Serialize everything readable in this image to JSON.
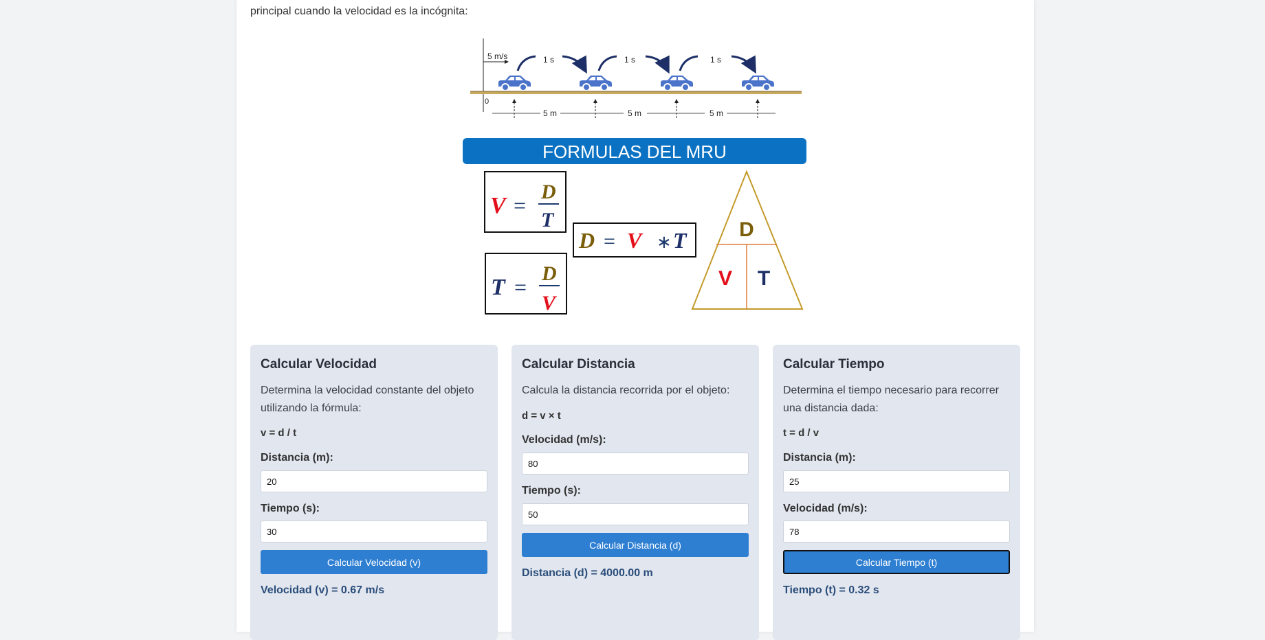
{
  "intro_text": "principal cuando la velocidad es la incógnita:",
  "motion_diagram": {
    "speed_label": "5 m/s",
    "origin_label": "0",
    "time_labels": [
      "1 s",
      "1 s",
      "1 s"
    ],
    "distance_labels": [
      "5 m",
      "5 m",
      "5 m"
    ]
  },
  "formulas_banner": {
    "title": "FORMULAS DEL MRU",
    "velocity": {
      "lhs": "V",
      "num": "D",
      "den": "T"
    },
    "time": {
      "lhs": "T",
      "num": "D",
      "den": "V"
    },
    "distance": {
      "lhs": "D",
      "a": "V",
      "op": "∗",
      "b": "T"
    },
    "triangle": {
      "top": "D",
      "left": "V",
      "right": "T"
    },
    "colors": {
      "distance": "#7a5e0a",
      "velocity": "#e3101b",
      "time": "#1d2f66",
      "banner": "#0b72c3"
    }
  },
  "calculators": {
    "velocity": {
      "title": "Calcular Velocidad",
      "description": "Determina la velocidad constante del objeto utilizando la fórmula:",
      "formula": "v = d / t",
      "field1_label": "Distancia (m):",
      "field1_value": "20",
      "field2_label": "Tiempo (s):",
      "field2_value": "30",
      "button_label": "Calcular Velocidad (v)",
      "result": "Velocidad (v) = 0.67 m/s"
    },
    "distance": {
      "title": "Calcular Distancia",
      "description": "Calcula la distancia recorrida por el objeto:",
      "formula": "d = v × t",
      "field1_label": "Velocidad (m/s):",
      "field1_value": "80",
      "field2_label": "Tiempo (s):",
      "field2_value": "50",
      "button_label": "Calcular Distancia (d)",
      "result": "Distancia (d) = 4000.00 m"
    },
    "time": {
      "title": "Calcular Tiempo",
      "description": "Determina el tiempo necesario para recorrer una distancia dada:",
      "formula": "t = d / v",
      "field1_label": "Distancia (m):",
      "field1_value": "25",
      "field2_label": "Velocidad (m/s):",
      "field2_value": "78",
      "button_label": "Calcular Tiempo (t)",
      "result": "Tiempo (t) = 0.32 s"
    }
  },
  "accent_color": "#2e7fd2"
}
